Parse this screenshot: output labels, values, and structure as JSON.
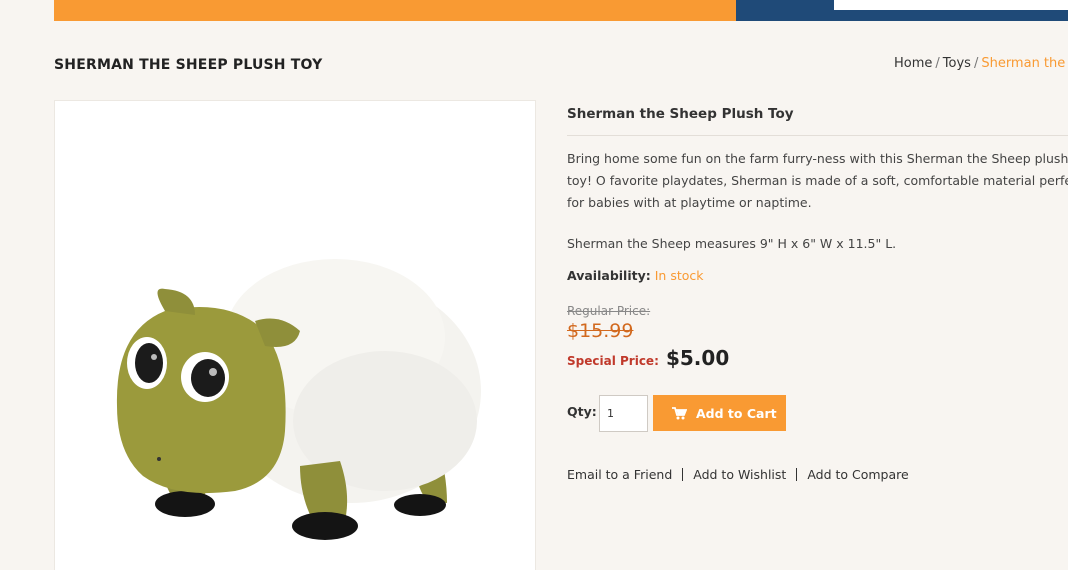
{
  "page": {
    "title": "SHERMAN THE SHEEP PLUSH TOY"
  },
  "breadcrumb": {
    "home": "Home",
    "toys": "Toys",
    "current": "Sherman the Sh",
    "separator": "/"
  },
  "product": {
    "name": "Sherman the Sheep Plush Toy",
    "description": "Bring home some fun on the farm furry-ness with this Sherman the Sheep plush toy! O favorite playdates, Sherman is made of a soft, comfortable material perfect for babies with at playtime or naptime.",
    "measures": "Sherman the Sheep measures 9\" H x 6\" W x 11.5\" L.",
    "availability_label": "Availability:",
    "availability_value": "In stock",
    "regular_price_label": "Regular Price:",
    "regular_price": "$15.99",
    "special_price_label": "Special Price:",
    "special_price": "$5.00",
    "image_icon": "sheep-plush-image"
  },
  "cart": {
    "qty_label": "Qty:",
    "qty_value": "1",
    "add_to_cart_label": "Add to Cart",
    "cart_icon": "cart-icon"
  },
  "actions": {
    "email_friend": "Email to a Friend",
    "add_wishlist": "Add to Wishlist",
    "add_compare": "Add to Compare"
  },
  "colors": {
    "accent": "#f99a33",
    "navy": "#1f4a78",
    "special_price": "#c0392b",
    "background": "#f8f5f1"
  }
}
